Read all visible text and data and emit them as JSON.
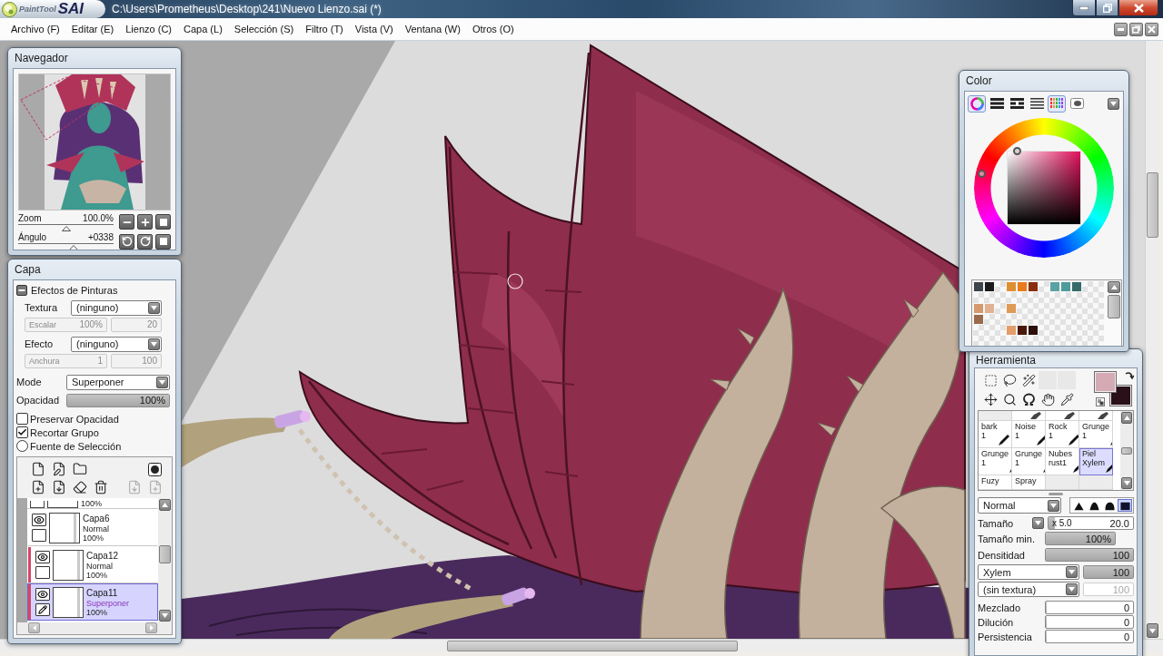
{
  "window": {
    "logo": {
      "name": "PaintTool",
      "mark": "SAI"
    },
    "title": "C:\\Users\\Prometheus\\Desktop\\241\\Nuevo Lienzo.sai (*)"
  },
  "menu": [
    {
      "label": "Archivo (F)"
    },
    {
      "label": "Editar (E)"
    },
    {
      "label": "Lienzo (C)"
    },
    {
      "label": "Capa (L)"
    },
    {
      "label": "Selección (S)"
    },
    {
      "label": "Filtro (T)"
    },
    {
      "label": "Vista (V)"
    },
    {
      "label": "Ventana (W)"
    },
    {
      "label": "Otros (O)"
    }
  ],
  "navigator": {
    "title": "Navegador",
    "sliders": [
      {
        "label": "Zoom",
        "value": "100.0%",
        "level": 0.5
      },
      {
        "label": "Ángulo",
        "value": "+0338",
        "level": 0.58
      }
    ]
  },
  "layer_panel": {
    "title": "Capa",
    "effects": {
      "label": "Efectos de Pinturas",
      "expanded": true,
      "rows": [
        {
          "label": "Textura",
          "value": "(ninguno)",
          "param_label": "Escalar",
          "param_value": "100%",
          "amount": "20",
          "params_disabled": true
        },
        {
          "label": "Efecto",
          "value": "(ninguno)",
          "param_label": "Anchura",
          "param_value": "1",
          "amount": "100",
          "params_disabled": true
        }
      ]
    },
    "mode": {
      "label": "Mode",
      "value": "Superponer"
    },
    "opacity": {
      "label": "Opacidad",
      "value": "100%",
      "level": 1
    },
    "options": [
      {
        "kind": "checkbox",
        "label": "Preservar Opacidad",
        "checked": false
      },
      {
        "kind": "checkbox",
        "label": "Recortar Grupo",
        "checked": true
      },
      {
        "kind": "radio",
        "label": "Fuente de Selección",
        "checked": false
      }
    ],
    "tools": [
      {
        "disabled": false
      },
      {
        "disabled": false
      },
      {
        "disabled": false
      },
      {
        "disabled": false
      },
      {
        "disabled": false
      },
      {
        "disabled": false
      },
      {
        "disabled": false
      },
      {
        "disabled": false
      },
      {
        "disabled": true
      },
      {
        "disabled": true
      }
    ],
    "layers": [
      {
        "kind": "partial",
        "opacity": "100%",
        "checked": false
      },
      {
        "kind": "layer",
        "name": "Capa6",
        "mode": "Normal",
        "opacity": "100%",
        "visible": true,
        "checked": false,
        "clipped": false,
        "selected": false
      },
      {
        "kind": "layer",
        "name": "Capa12",
        "mode": "Normal",
        "opacity": "100%",
        "visible": true,
        "checked": false,
        "clipped": true,
        "selected": false
      },
      {
        "kind": "layer",
        "name": "Capa11",
        "mode": "Superponer",
        "opacity": "100%",
        "visible": true,
        "checked": false,
        "clipped": true,
        "selected": true
      }
    ]
  },
  "color_panel": {
    "title": "Color",
    "modes": [
      {
        "on": true
      },
      {
        "on": false
      },
      {
        "on": false
      },
      {
        "on": false
      },
      {
        "on": true
      },
      {
        "on": false
      }
    ],
    "swatch_rows": [
      {
        "cells": [
          {
            "kind": "color",
            "color": "#3d444b"
          },
          {
            "kind": "color",
            "color": "#1a1a1d"
          },
          {
            "kind": "empty"
          },
          {
            "kind": "color",
            "color": "#de8f32"
          },
          {
            "kind": "color",
            "color": "#ea7a1a"
          },
          {
            "kind": "color",
            "color": "#8a2e10"
          },
          {
            "kind": "empty"
          },
          {
            "kind": "color",
            "color": "#5aa2a3"
          },
          {
            "kind": "color",
            "color": "#4f9b9c"
          },
          {
            "kind": "color",
            "color": "#366b69"
          },
          {
            "kind": "empty"
          },
          {
            "kind": "empty"
          }
        ]
      },
      {
        "cells": [
          {
            "kind": "empty"
          },
          {
            "kind": "empty"
          },
          {
            "kind": "empty"
          },
          {
            "kind": "empty"
          },
          {
            "kind": "empty"
          },
          {
            "kind": "empty"
          },
          {
            "kind": "empty"
          },
          {
            "kind": "empty"
          },
          {
            "kind": "empty"
          },
          {
            "kind": "empty"
          },
          {
            "kind": "empty"
          },
          {
            "kind": "empty"
          }
        ]
      },
      {
        "cells": [
          {
            "kind": "color",
            "color": "#d49a6e"
          },
          {
            "kind": "color",
            "color": "#e0b293"
          },
          {
            "kind": "empty"
          },
          {
            "kind": "color",
            "color": "#dd9b55"
          },
          {
            "kind": "empty"
          },
          {
            "kind": "empty"
          },
          {
            "kind": "empty"
          },
          {
            "kind": "empty"
          },
          {
            "kind": "empty"
          },
          {
            "kind": "empty"
          },
          {
            "kind": "empty"
          },
          {
            "kind": "empty"
          }
        ]
      },
      {
        "cells": [
          {
            "kind": "color",
            "color": "#9a6b4b"
          },
          {
            "kind": "empty"
          },
          {
            "kind": "empty"
          },
          {
            "kind": "empty"
          },
          {
            "kind": "empty"
          },
          {
            "kind": "empty"
          },
          {
            "kind": "empty"
          },
          {
            "kind": "empty"
          },
          {
            "kind": "empty"
          },
          {
            "kind": "empty"
          },
          {
            "kind": "empty"
          },
          {
            "kind": "empty"
          }
        ]
      },
      {
        "cells": [
          {
            "kind": "empty"
          },
          {
            "kind": "empty"
          },
          {
            "kind": "empty"
          },
          {
            "kind": "color",
            "color": "#e39d6b"
          },
          {
            "kind": "color",
            "color": "#4a190a"
          },
          {
            "kind": "color",
            "color": "#2c0f08"
          },
          {
            "kind": "empty"
          },
          {
            "kind": "empty"
          },
          {
            "kind": "empty"
          },
          {
            "kind": "empty"
          },
          {
            "kind": "empty"
          },
          {
            "kind": "empty"
          }
        ]
      },
      {
        "cells": [
          {
            "kind": "empty"
          },
          {
            "kind": "empty"
          },
          {
            "kind": "empty"
          },
          {
            "kind": "empty"
          },
          {
            "kind": "empty"
          },
          {
            "kind": "empty"
          },
          {
            "kind": "empty"
          },
          {
            "kind": "empty"
          },
          {
            "kind": "empty"
          },
          {
            "kind": "empty"
          },
          {
            "kind": "empty"
          },
          {
            "kind": "empty"
          }
        ]
      },
      {
        "cells": [
          {
            "kind": "empty"
          },
          {
            "kind": "empty"
          },
          {
            "kind": "empty"
          },
          {
            "kind": "empty"
          },
          {
            "kind": "empty"
          },
          {
            "kind": "empty"
          },
          {
            "kind": "empty"
          },
          {
            "kind": "empty"
          },
          {
            "kind": "empty"
          },
          {
            "kind": "empty"
          },
          {
            "kind": "empty"
          },
          {
            "kind": "empty"
          }
        ]
      }
    ]
  },
  "tool_panel": {
    "title": "Herramienta",
    "colors": [
      {
        "color": "#d6aab5"
      },
      {
        "color": "#2a1018"
      }
    ],
    "brushes": [
      {
        "name": "bark",
        "name_2": "1",
        "selected": false
      },
      {
        "name": "Noise",
        "name_2": "1",
        "selected": false
      },
      {
        "name": "Rock",
        "name_2": "1",
        "selected": false
      },
      {
        "name": "Grunge",
        "name_2": "1",
        "selected": false
      },
      {
        "name": "Grunge",
        "name_2": "1",
        "selected": false
      },
      {
        "name": "Grunge",
        "name_2": "1",
        "selected": false
      },
      {
        "name": "Nubes",
        "name_2": "rust1",
        "selected": false
      },
      {
        "name": "Piel",
        "name_2": "Xylem",
        "selected": true
      },
      {
        "name": "Fuzy",
        "selected": false
      },
      {
        "name": "Spray",
        "selected": false
      }
    ],
    "blend": {
      "value": "Normal"
    },
    "tips": [
      {
        "selected": false
      },
      {
        "selected": false
      },
      {
        "selected": false
      },
      {
        "selected": true
      }
    ],
    "params": [
      {
        "kind": "size",
        "label": "Tamaño",
        "multiplier": "x 5.0",
        "value": "20.0",
        "level": 0.07
      },
      {
        "kind": "short-bar",
        "label": "Tamaño min.",
        "value": "100%",
        "level": 1
      },
      {
        "kind": "bar",
        "label": "Densitidad",
        "value": "100",
        "level": 1
      },
      {
        "kind": "select",
        "value": "Xylem",
        "amount": "100",
        "level": 1,
        "disabled": false
      },
      {
        "kind": "select",
        "value": "(sin textura)",
        "amount": "100",
        "disabled": true
      },
      {
        "kind": "bar",
        "label": "Mezclado",
        "value": "0",
        "level": 0
      },
      {
        "kind": "bar",
        "label": "Dilución",
        "value": "0",
        "level": 0
      },
      {
        "kind": "bar",
        "label": "Persistencia",
        "value": "0",
        "level": 0
      }
    ]
  }
}
